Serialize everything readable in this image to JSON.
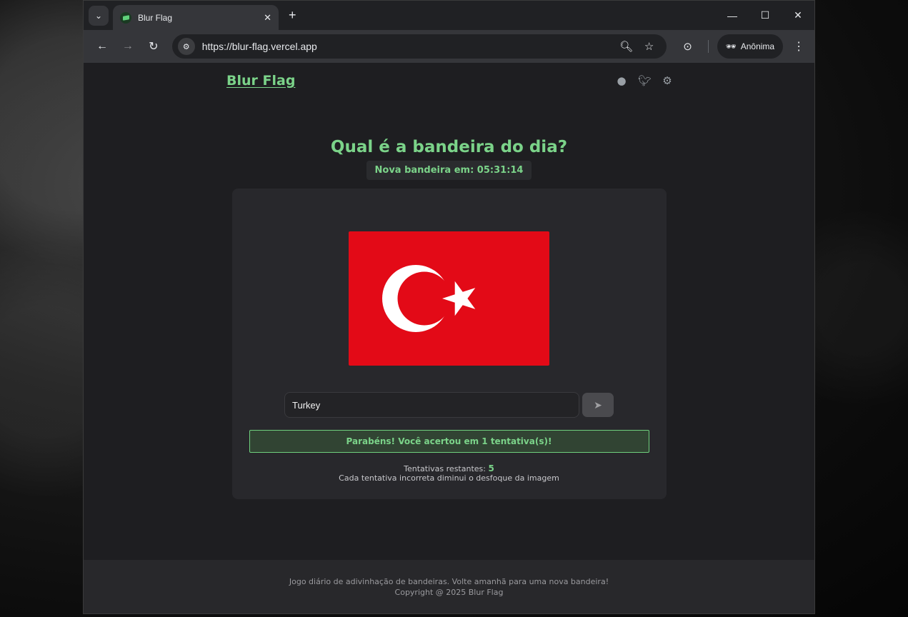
{
  "browser": {
    "tab_title": "Blur Flag",
    "url": "https://blur-flag.vercel.app",
    "incognito_label": "Anônima"
  },
  "site": {
    "brand": "Blur Flag",
    "heading": "Qual é a bandeira do dia?",
    "timer": "Nova bandeira em: 05:31:14",
    "flag_colors": {
      "background": "#e30a17",
      "emblem": "#ffffff"
    },
    "guess_value": "Turkey",
    "success_message": "Parabéns! Você acertou em 1 tentativa(s)!",
    "attempts_label": "Tentativas restantes:",
    "attempts_value": "5",
    "hint": "Cada tentativa incorreta diminui o desfoque da imagem",
    "footer_line1": "Jogo diário de adivinhação de bandeiras. Volte amanhã para uma nova bandeira!",
    "footer_line2": "Copyright @ 2025 Blur Flag"
  },
  "colors": {
    "accent": "#7bd389",
    "page_bg": "#1e1e21",
    "card_bg": "#28282c"
  }
}
